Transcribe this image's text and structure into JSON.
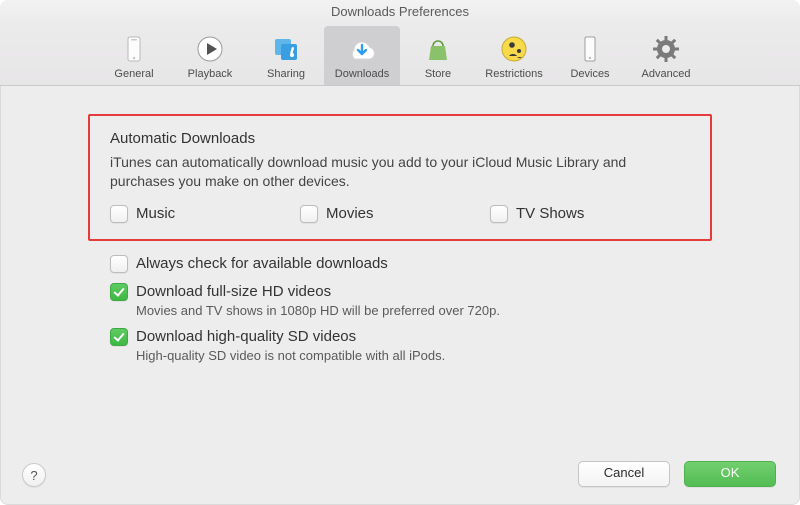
{
  "window": {
    "title": "Downloads Preferences"
  },
  "toolbar": {
    "items": [
      {
        "label": "General",
        "selected": false
      },
      {
        "label": "Playback",
        "selected": false
      },
      {
        "label": "Sharing",
        "selected": false
      },
      {
        "label": "Downloads",
        "selected": true
      },
      {
        "label": "Store",
        "selected": false
      },
      {
        "label": "Restrictions",
        "selected": false
      },
      {
        "label": "Devices",
        "selected": false
      },
      {
        "label": "Advanced",
        "selected": false
      }
    ]
  },
  "auto": {
    "title": "Automatic Downloads",
    "desc": "iTunes can automatically download music you add to your iCloud Music Library and purchases you make on other devices.",
    "options": [
      {
        "label": "Music",
        "checked": false
      },
      {
        "label": "Movies",
        "checked": false
      },
      {
        "label": "TV Shows",
        "checked": false
      }
    ]
  },
  "other_options": [
    {
      "label": "Always check for available downloads",
      "checked": false,
      "hint": ""
    },
    {
      "label": "Download full-size HD videos",
      "checked": true,
      "hint": "Movies and TV shows in 1080p HD will be preferred over 720p."
    },
    {
      "label": "Download high-quality SD videos",
      "checked": true,
      "hint": "High-quality SD video is not compatible with all iPods."
    }
  ],
  "buttons": {
    "cancel": "Cancel",
    "ok": "OK",
    "help": "?"
  },
  "colors": {
    "highlight_border": "#e63b3b",
    "checkbox_checked": "#4cc24f",
    "primary_button": "#5dc55d"
  }
}
